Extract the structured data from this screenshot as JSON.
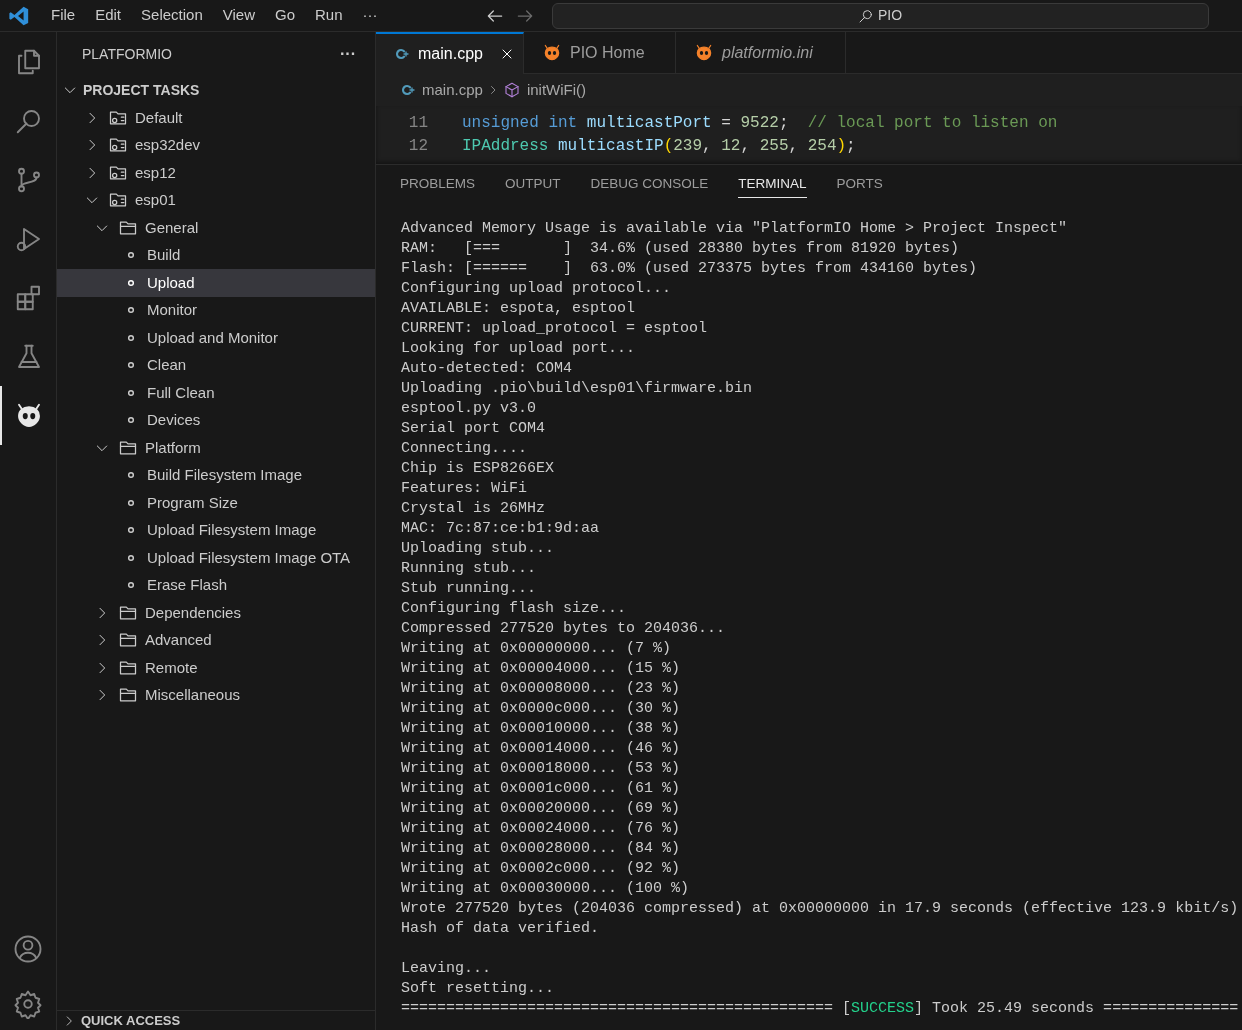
{
  "menu": [
    "File",
    "Edit",
    "Selection",
    "View",
    "Go",
    "Run",
    "···"
  ],
  "search": {
    "value": "PIO"
  },
  "activity_bar": [
    {
      "kind": "files",
      "selected": false
    },
    {
      "kind": "search",
      "selected": false
    },
    {
      "kind": "branch",
      "selected": false
    },
    {
      "kind": "debug",
      "selected": false
    },
    {
      "kind": "extensions",
      "selected": false
    },
    {
      "kind": "flask",
      "selected": false
    },
    {
      "kind": "alien",
      "selected": true
    }
  ],
  "sidebar": {
    "title": "PLATFORMIO",
    "more": "···",
    "section": {
      "label": "PROJECT TASKS",
      "expanded": true
    },
    "tree": [
      {
        "kind": "env",
        "label": "Default",
        "expanded": false,
        "selected": false
      },
      {
        "kind": "env",
        "label": "esp32dev",
        "expanded": false,
        "selected": false
      },
      {
        "kind": "env",
        "label": "esp12",
        "expanded": false,
        "selected": false
      },
      {
        "kind": "env",
        "label": "esp01",
        "expanded": true,
        "selected": false,
        "children": [
          {
            "kind": "folder",
            "label": "General",
            "expanded": true,
            "selected": false,
            "children": [
              {
                "kind": "task",
                "label": "Build",
                "selected": false
              },
              {
                "kind": "task",
                "label": "Upload",
                "selected": true
              },
              {
                "kind": "task",
                "label": "Monitor",
                "selected": false
              },
              {
                "kind": "task",
                "label": "Upload and Monitor",
                "selected": false
              },
              {
                "kind": "task",
                "label": "Clean",
                "selected": false
              },
              {
                "kind": "task",
                "label": "Full Clean",
                "selected": false
              },
              {
                "kind": "task",
                "label": "Devices",
                "selected": false
              }
            ]
          },
          {
            "kind": "folder",
            "label": "Platform",
            "expanded": true,
            "selected": false,
            "children": [
              {
                "kind": "task",
                "label": "Build Filesystem Image",
                "selected": false
              },
              {
                "kind": "task",
                "label": "Program Size",
                "selected": false
              },
              {
                "kind": "task",
                "label": "Upload Filesystem Image",
                "selected": false
              },
              {
                "kind": "task",
                "label": "Upload Filesystem Image OTA",
                "selected": false
              },
              {
                "kind": "task",
                "label": "Erase Flash",
                "selected": false
              }
            ]
          },
          {
            "kind": "folder",
            "label": "Dependencies",
            "expanded": false,
            "selected": false
          },
          {
            "kind": "folder",
            "label": "Advanced",
            "expanded": false,
            "selected": false
          },
          {
            "kind": "folder",
            "label": "Remote",
            "expanded": false,
            "selected": false
          },
          {
            "kind": "folder",
            "label": "Miscellaneous",
            "expanded": false,
            "selected": false
          }
        ]
      }
    ],
    "footer_section": {
      "label": "QUICK ACCESS",
      "expanded": false
    }
  },
  "tabs": [
    {
      "label": "main.cpp",
      "kind": "source",
      "selected": true,
      "preview": false
    },
    {
      "label": "PIO Home",
      "kind": "platformio",
      "selected": false,
      "preview": false
    },
    {
      "label": "platformio.ini",
      "kind": "platformio",
      "selected": false,
      "preview": true
    }
  ],
  "breadcrumb": [
    {
      "label": "main.cpp",
      "kind": "source"
    },
    {
      "label": "initWiFi()",
      "kind": "symbol"
    }
  ],
  "code": [
    {
      "number": "11",
      "tokens": [
        {
          "kind": "keyword",
          "text": "unsigned int "
        },
        {
          "kind": "variable",
          "text": "multicastPort"
        },
        {
          "kind": "plain",
          "text": " = "
        },
        {
          "kind": "number",
          "text": "9522"
        },
        {
          "kind": "plain",
          "text": ";  "
        },
        {
          "kind": "comment",
          "text": "// local port to listen on"
        }
      ]
    },
    {
      "number": "12",
      "tokens": [
        {
          "kind": "type",
          "text": "IPAddress "
        },
        {
          "kind": "variable",
          "text": "multicastIP"
        },
        {
          "kind": "bracket",
          "text": "("
        },
        {
          "kind": "number",
          "text": "239"
        },
        {
          "kind": "plain",
          "text": ", "
        },
        {
          "kind": "number",
          "text": "12"
        },
        {
          "kind": "plain",
          "text": ", "
        },
        {
          "kind": "number",
          "text": "255"
        },
        {
          "kind": "plain",
          "text": ", "
        },
        {
          "kind": "number",
          "text": "254"
        },
        {
          "kind": "bracket",
          "text": ")"
        },
        {
          "kind": "plain",
          "text": ";"
        }
      ]
    }
  ],
  "panel_tabs": [
    {
      "label": "PROBLEMS",
      "selected": false
    },
    {
      "label": "OUTPUT",
      "selected": false
    },
    {
      "label": "DEBUG CONSOLE",
      "selected": false
    },
    {
      "label": "TERMINAL",
      "selected": true
    },
    {
      "label": "PORTS",
      "selected": false
    }
  ],
  "terminal": [
    {
      "kind": "text",
      "text": "Advanced Memory Usage is available via \"PlatformIO Home > Project Inspect\""
    },
    {
      "kind": "text",
      "text": "RAM:   [===       ]  34.6% (used 28380 bytes from 81920 bytes)"
    },
    {
      "kind": "text",
      "text": "Flash: [======    ]  63.0% (used 273375 bytes from 434160 bytes)"
    },
    {
      "kind": "text",
      "text": "Configuring upload protocol..."
    },
    {
      "kind": "text",
      "text": "AVAILABLE: espota, esptool"
    },
    {
      "kind": "text",
      "text": "CURRENT: upload_protocol = esptool"
    },
    {
      "kind": "text",
      "text": "Looking for upload port..."
    },
    {
      "kind": "text",
      "text": "Auto-detected: COM4"
    },
    {
      "kind": "text",
      "text": "Uploading .pio\\build\\esp01\\firmware.bin"
    },
    {
      "kind": "text",
      "text": "esptool.py v3.0"
    },
    {
      "kind": "text",
      "text": "Serial port COM4"
    },
    {
      "kind": "text",
      "text": "Connecting...."
    },
    {
      "kind": "text",
      "text": "Chip is ESP8266EX"
    },
    {
      "kind": "text",
      "text": "Features: WiFi"
    },
    {
      "kind": "text",
      "text": "Crystal is 26MHz"
    },
    {
      "kind": "text",
      "text": "MAC: 7c:87:ce:b1:9d:aa"
    },
    {
      "kind": "text",
      "text": "Uploading stub..."
    },
    {
      "kind": "text",
      "text": "Running stub..."
    },
    {
      "kind": "text",
      "text": "Stub running..."
    },
    {
      "kind": "text",
      "text": "Configuring flash size..."
    },
    {
      "kind": "text",
      "text": "Compressed 277520 bytes to 204036..."
    },
    {
      "kind": "text",
      "text": "Writing at 0x00000000... (7 %)"
    },
    {
      "kind": "text",
      "text": "Writing at 0x00004000... (15 %)"
    },
    {
      "kind": "text",
      "text": "Writing at 0x00008000... (23 %)"
    },
    {
      "kind": "text",
      "text": "Writing at 0x0000c000... (30 %)"
    },
    {
      "kind": "text",
      "text": "Writing at 0x00010000... (38 %)"
    },
    {
      "kind": "text",
      "text": "Writing at 0x00014000... (46 %)"
    },
    {
      "kind": "text",
      "text": "Writing at 0x00018000... (53 %)"
    },
    {
      "kind": "text",
      "text": "Writing at 0x0001c000... (61 %)"
    },
    {
      "kind": "text",
      "text": "Writing at 0x00020000... (69 %)"
    },
    {
      "kind": "text",
      "text": "Writing at 0x00024000... (76 %)"
    },
    {
      "kind": "text",
      "text": "Writing at 0x00028000... (84 %)"
    },
    {
      "kind": "text",
      "text": "Writing at 0x0002c000... (92 %)"
    },
    {
      "kind": "text",
      "text": "Writing at 0x00030000... (100 %)"
    },
    {
      "kind": "text",
      "text": "Wrote 277520 bytes (204036 compressed) at 0x00000000 in 17.9 seconds (effective 123.9 kbit/s)"
    },
    {
      "kind": "text",
      "text": "Hash of data verified."
    },
    {
      "kind": "blank"
    },
    {
      "kind": "text",
      "text": "Leaving..."
    },
    {
      "kind": "text",
      "text": "Soft resetting..."
    },
    {
      "kind": "result",
      "before": "================================================ [",
      "status": "SUCCESS",
      "after": "] Took 25.49 seconds ==============="
    }
  ]
}
